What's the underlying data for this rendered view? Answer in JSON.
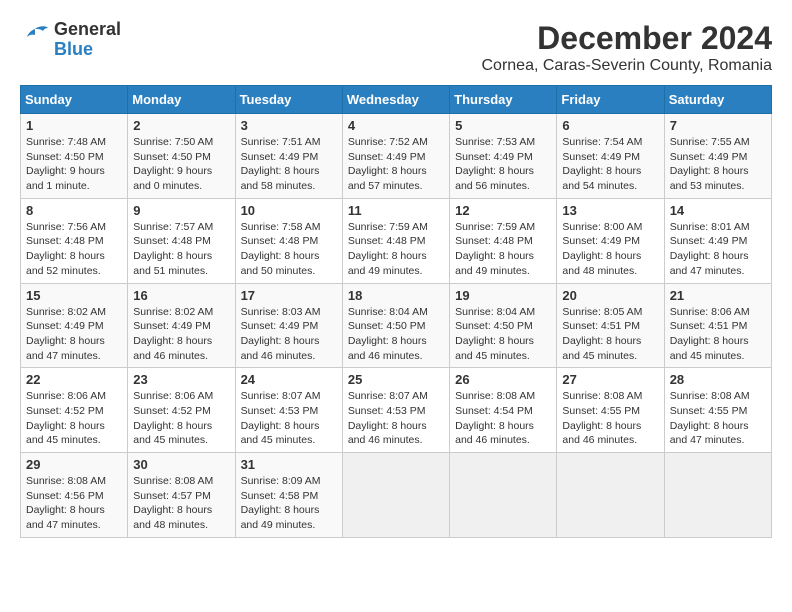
{
  "logo": {
    "general": "General",
    "blue": "Blue"
  },
  "title": "December 2024",
  "subtitle": "Cornea, Caras-Severin County, Romania",
  "days_header": [
    "Sunday",
    "Monday",
    "Tuesday",
    "Wednesday",
    "Thursday",
    "Friday",
    "Saturday"
  ],
  "weeks": [
    [
      {
        "day": "1",
        "sunrise": "7:48 AM",
        "sunset": "4:50 PM",
        "daylight": "9 hours and 1 minute."
      },
      {
        "day": "2",
        "sunrise": "7:50 AM",
        "sunset": "4:50 PM",
        "daylight": "9 hours and 0 minutes."
      },
      {
        "day": "3",
        "sunrise": "7:51 AM",
        "sunset": "4:49 PM",
        "daylight": "8 hours and 58 minutes."
      },
      {
        "day": "4",
        "sunrise": "7:52 AM",
        "sunset": "4:49 PM",
        "daylight": "8 hours and 57 minutes."
      },
      {
        "day": "5",
        "sunrise": "7:53 AM",
        "sunset": "4:49 PM",
        "daylight": "8 hours and 56 minutes."
      },
      {
        "day": "6",
        "sunrise": "7:54 AM",
        "sunset": "4:49 PM",
        "daylight": "8 hours and 54 minutes."
      },
      {
        "day": "7",
        "sunrise": "7:55 AM",
        "sunset": "4:49 PM",
        "daylight": "8 hours and 53 minutes."
      }
    ],
    [
      {
        "day": "8",
        "sunrise": "7:56 AM",
        "sunset": "4:48 PM",
        "daylight": "8 hours and 52 minutes."
      },
      {
        "day": "9",
        "sunrise": "7:57 AM",
        "sunset": "4:48 PM",
        "daylight": "8 hours and 51 minutes."
      },
      {
        "day": "10",
        "sunrise": "7:58 AM",
        "sunset": "4:48 PM",
        "daylight": "8 hours and 50 minutes."
      },
      {
        "day": "11",
        "sunrise": "7:59 AM",
        "sunset": "4:48 PM",
        "daylight": "8 hours and 49 minutes."
      },
      {
        "day": "12",
        "sunrise": "7:59 AM",
        "sunset": "4:48 PM",
        "daylight": "8 hours and 49 minutes."
      },
      {
        "day": "13",
        "sunrise": "8:00 AM",
        "sunset": "4:49 PM",
        "daylight": "8 hours and 48 minutes."
      },
      {
        "day": "14",
        "sunrise": "8:01 AM",
        "sunset": "4:49 PM",
        "daylight": "8 hours and 47 minutes."
      }
    ],
    [
      {
        "day": "15",
        "sunrise": "8:02 AM",
        "sunset": "4:49 PM",
        "daylight": "8 hours and 47 minutes."
      },
      {
        "day": "16",
        "sunrise": "8:02 AM",
        "sunset": "4:49 PM",
        "daylight": "8 hours and 46 minutes."
      },
      {
        "day": "17",
        "sunrise": "8:03 AM",
        "sunset": "4:49 PM",
        "daylight": "8 hours and 46 minutes."
      },
      {
        "day": "18",
        "sunrise": "8:04 AM",
        "sunset": "4:50 PM",
        "daylight": "8 hours and 46 minutes."
      },
      {
        "day": "19",
        "sunrise": "8:04 AM",
        "sunset": "4:50 PM",
        "daylight": "8 hours and 45 minutes."
      },
      {
        "day": "20",
        "sunrise": "8:05 AM",
        "sunset": "4:51 PM",
        "daylight": "8 hours and 45 minutes."
      },
      {
        "day": "21",
        "sunrise": "8:06 AM",
        "sunset": "4:51 PM",
        "daylight": "8 hours and 45 minutes."
      }
    ],
    [
      {
        "day": "22",
        "sunrise": "8:06 AM",
        "sunset": "4:52 PM",
        "daylight": "8 hours and 45 minutes."
      },
      {
        "day": "23",
        "sunrise": "8:06 AM",
        "sunset": "4:52 PM",
        "daylight": "8 hours and 45 minutes."
      },
      {
        "day": "24",
        "sunrise": "8:07 AM",
        "sunset": "4:53 PM",
        "daylight": "8 hours and 45 minutes."
      },
      {
        "day": "25",
        "sunrise": "8:07 AM",
        "sunset": "4:53 PM",
        "daylight": "8 hours and 46 minutes."
      },
      {
        "day": "26",
        "sunrise": "8:08 AM",
        "sunset": "4:54 PM",
        "daylight": "8 hours and 46 minutes."
      },
      {
        "day": "27",
        "sunrise": "8:08 AM",
        "sunset": "4:55 PM",
        "daylight": "8 hours and 46 minutes."
      },
      {
        "day": "28",
        "sunrise": "8:08 AM",
        "sunset": "4:55 PM",
        "daylight": "8 hours and 47 minutes."
      }
    ],
    [
      {
        "day": "29",
        "sunrise": "8:08 AM",
        "sunset": "4:56 PM",
        "daylight": "8 hours and 47 minutes."
      },
      {
        "day": "30",
        "sunrise": "8:08 AM",
        "sunset": "4:57 PM",
        "daylight": "8 hours and 48 minutes."
      },
      {
        "day": "31",
        "sunrise": "8:09 AM",
        "sunset": "4:58 PM",
        "daylight": "8 hours and 49 minutes."
      },
      null,
      null,
      null,
      null
    ]
  ],
  "labels": {
    "sunrise": "Sunrise:",
    "sunset": "Sunset:",
    "daylight": "Daylight:"
  }
}
